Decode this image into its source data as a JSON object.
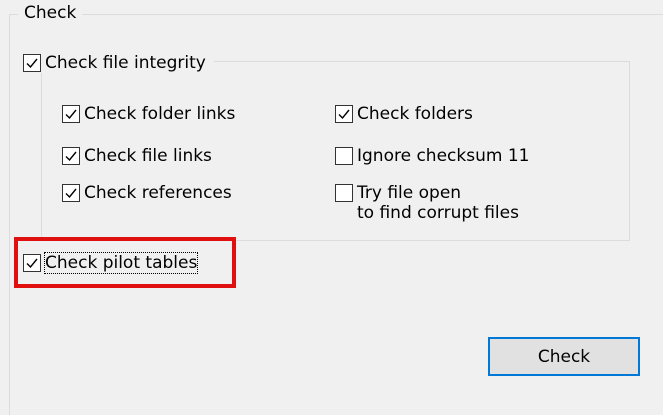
{
  "group_title": "Check",
  "integrity": {
    "label": "Check file integrity",
    "checked": true
  },
  "options": [
    {
      "label": "Check folder links",
      "checked": true
    },
    {
      "label": "Check file links",
      "checked": true
    },
    {
      "label": "Check references",
      "checked": true
    },
    {
      "label": "Check folders",
      "checked": true
    },
    {
      "label": "Ignore checksum 11",
      "checked": false
    },
    {
      "label_line1": "Try file open",
      "label_line2": "to find corrupt files",
      "checked": false
    }
  ],
  "pilot_tables": {
    "label": "Check pilot tables",
    "checked": true
  },
  "check_button": "Check",
  "highlight_color": "#e01010",
  "focus_color": "#0078d7"
}
